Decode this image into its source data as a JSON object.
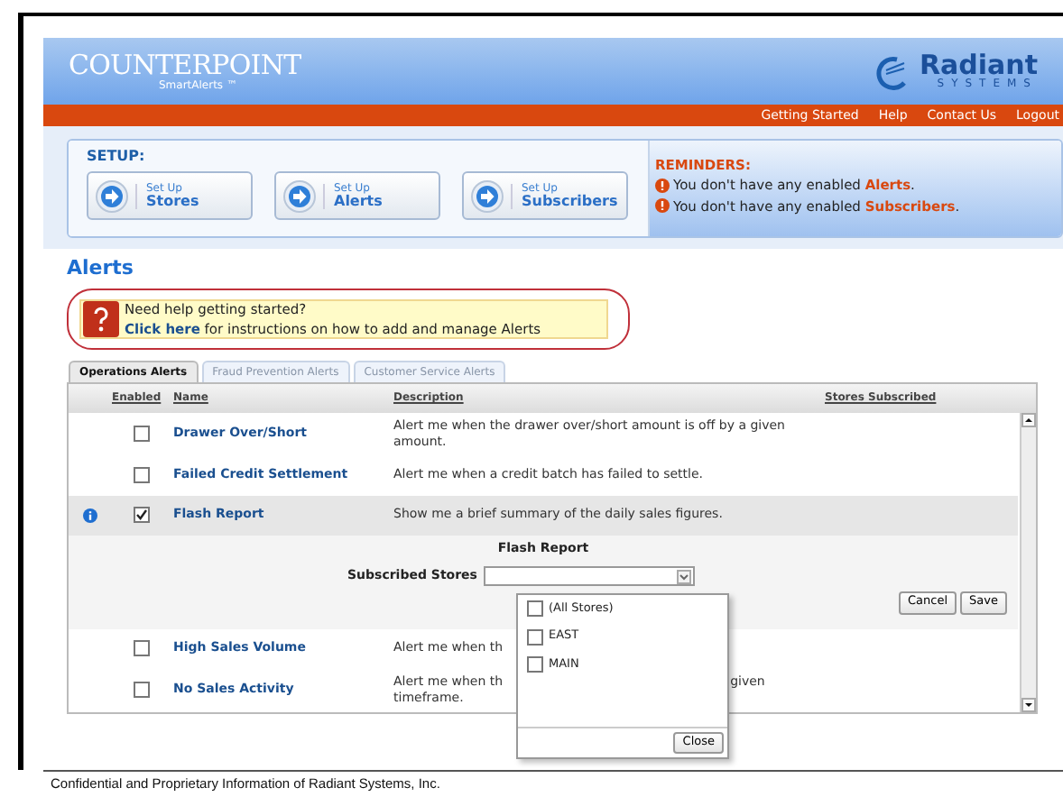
{
  "header": {
    "logo": "COUNTERPOINT",
    "logo_sub": "SmartAlerts ™",
    "brand": "Radiant",
    "brand_sub": "SYSTEMS"
  },
  "nav": [
    "Getting Started",
    "Help",
    "Contact Us",
    "Logout"
  ],
  "setup": {
    "title": "SETUP:",
    "buttons": [
      {
        "small": "Set Up",
        "big": "Stores"
      },
      {
        "small": "Set Up",
        "big": "Alerts"
      },
      {
        "small": "Set Up",
        "big": "Subscribers"
      }
    ]
  },
  "reminders": {
    "title": "REMINDERS:",
    "items": [
      "You don't have any enabled **Alerts**.",
      "You don't have any enabled **Subscribers**."
    ]
  },
  "page_title": "Alerts",
  "help": {
    "line1": "Need help getting started?",
    "link": "Click here",
    "line2": " for instructions on how to add and manage Alerts"
  },
  "tabs": [
    {
      "label": "Operations Alerts",
      "selected": true
    },
    {
      "label": "Fraud Prevention Alerts",
      "selected": false
    },
    {
      "label": "Customer Service Alerts",
      "selected": false
    }
  ],
  "table": {
    "columns": [
      "Enabled",
      "Name",
      "Description",
      "Stores Subscribed"
    ],
    "rows": [
      {
        "name": "Drawer Over/Short",
        "description_lines": [
          [
            "Alert me when the drawer over/short amount is off by a given"
          ],
          [
            "amount."
          ]
        ],
        "checked": false,
        "info": false,
        "selected": false
      },
      {
        "name": "Failed Credit Settlement",
        "description_lines": [
          [
            "Alert me when a credit batch has failed to settle."
          ]
        ],
        "checked": false,
        "info": false,
        "selected": false
      },
      {
        "name": "Flash Report",
        "description_lines": [
          [
            "Show me a brief summary of the daily sales figures."
          ]
        ],
        "checked": true,
        "info": true,
        "selected": true
      },
      {
        "name": "High Sales Volume",
        "description_lines": [
          [
            "Alert me when th"
          ]
        ],
        "checked": false,
        "info": false,
        "selected": false
      },
      {
        "name": "No Sales Activity",
        "description_lines": [
          [
            "Alert me when th",
            "given"
          ],
          [
            "timeframe."
          ]
        ],
        "checked": false,
        "info": false,
        "selected": false
      }
    ],
    "detail": {
      "title": "Flash Report",
      "label": "Subscribed Stores",
      "buttons": [
        "Cancel",
        "Save"
      ]
    }
  },
  "store_popup": {
    "options": [
      {
        "label": "(All Stores)",
        "checked": false
      },
      {
        "label": "EAST",
        "checked": false
      },
      {
        "label": "MAIN",
        "checked": false
      }
    ],
    "close": "Close"
  },
  "footer": "Confidential and Proprietary Information of Radiant Systems, Inc."
}
